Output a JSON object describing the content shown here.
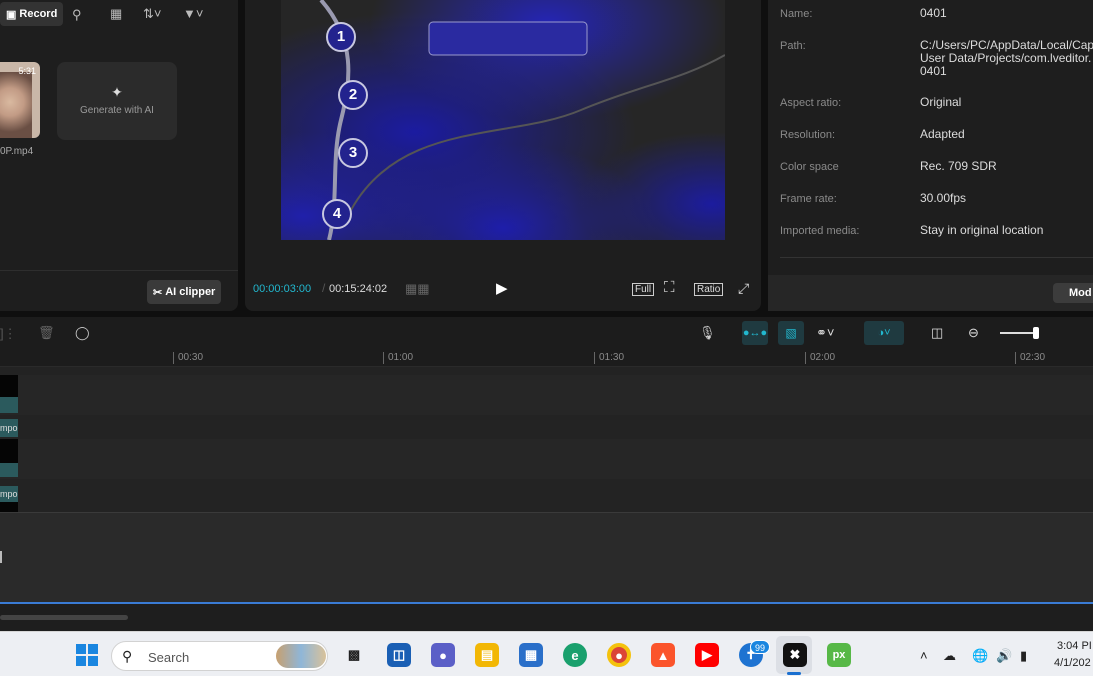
{
  "media_panel": {
    "record_label": "Record",
    "clip_duration": "5:31",
    "clip_filename": "0P.mp4",
    "generate_label": "Generate with AI",
    "ai_clipper_label": "AI clipper"
  },
  "player": {
    "current_time": "00:00:03:00",
    "total_time": "00:15:24:02",
    "full_label": "Full",
    "ratio_label": "Ratio",
    "steps": [
      "1",
      "2",
      "3",
      "4"
    ]
  },
  "details": {
    "rows": [
      {
        "label": "Name:",
        "value": "0401"
      },
      {
        "label": "Path:",
        "value": "C:/Users/PC/AppData/Local/Cap User Data/Projects/com.lveditor. 0401"
      },
      {
        "label": "Aspect ratio:",
        "value": "Original"
      },
      {
        "label": "Resolution:",
        "value": "Adapted"
      },
      {
        "label": "Color space",
        "value": "Rec. 709 SDR"
      },
      {
        "label": "Frame rate:",
        "value": "30.00fps"
      },
      {
        "label": "Imported media:",
        "value": "Stay in original location"
      }
    ],
    "modify_label": "Mod"
  },
  "timeline": {
    "ruler": [
      "00:30",
      "01:00",
      "01:30",
      "02:00",
      "02:30"
    ],
    "clip_label_a": "mpo",
    "clip_label_b": "mpo",
    "zoom_level": 0.88
  },
  "taskbar": {
    "search_placeholder": "Search",
    "badge_count": "99",
    "time": "3:04 PI",
    "date": "4/1/202"
  },
  "colors": {
    "accent": "#22b8cf",
    "panel": "#1e1e1e",
    "video_blue": "#16168a"
  }
}
